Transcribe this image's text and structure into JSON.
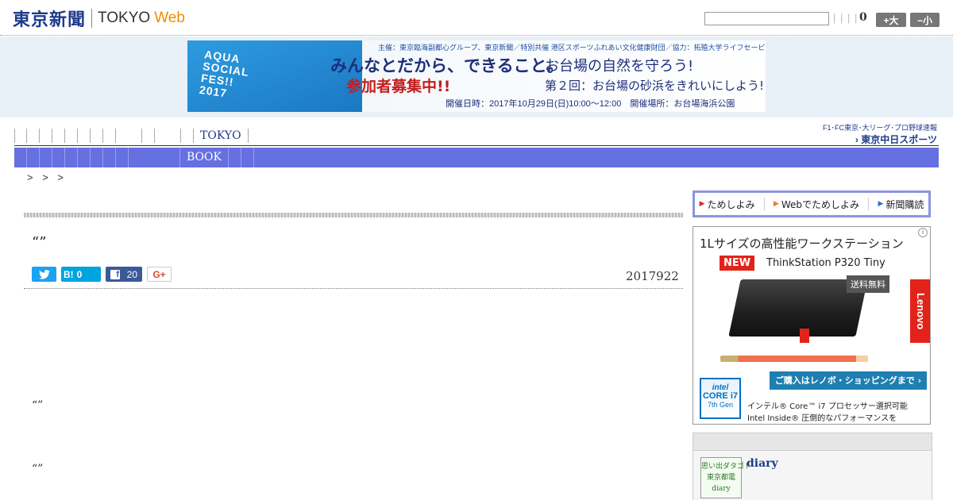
{
  "header": {
    "logo_jp": "東京新聞",
    "logo_tokyo": "TOKYO",
    "logo_web": "Web",
    "pipes": "| | | |",
    "count": "0",
    "font_big": "+大",
    "font_small": "−小"
  },
  "banner": {
    "shirt_text": "AQUA\nSOCIAL\nFES!!\n2017",
    "top_line": "主催：東京臨海副都心グループ、東京新聞／特別共催 港区スポーツふれあい文化健康財団／協力：拓殖大学ライフセービング部",
    "main1": "みんなとだから、できること。",
    "main2": "お台場の自然を守ろう!",
    "sub1": "参加者募集中!!",
    "sub2": "第２回：お台場の砂浜をきれいにしよう!",
    "bottom_line": "開催日時：2017年10月29日(日)10:00〜12:00　開催場所：お台場海浜公園"
  },
  "gnav": {
    "label": "TOKYO"
  },
  "chunichi": {
    "line1": "F1･FC東京･大リーグ･プロ野球速報",
    "line2": "› 東京中日スポーツ"
  },
  "subnav": {
    "label": "BOOK"
  },
  "breadcrumb": ">   > >",
  "article": {
    "title": "“”",
    "date": "2017922",
    "quote1": "“”",
    "quote2": "“”"
  },
  "share": {
    "twitter_icon": "twitter-icon",
    "hatena_label": "B!",
    "hatena_count": "0",
    "fb_label": "f",
    "fb_count": "20",
    "gplus_label": "G+"
  },
  "sidebar": {
    "tame_items": [
      "ためしよみ",
      "Webでためしよみ",
      "新聞購読"
    ],
    "ad": {
      "title": "1Lサイズの高性能ワークステーション",
      "new": "NEW",
      "model": "ThinkStation P320 Tiny",
      "free": "送料無料",
      "lenovo": "Lenovo",
      "cta": "ご購入はレノボ・ショッピングまで ›",
      "intel_brand": "intel",
      "intel_core": "CORE i7",
      "intel_gen": "7th Gen",
      "line1": "インテル® Core™ i7 プロセッサー選択可能",
      "line2": "Intel Inside® 圧倒的なパフォーマンスを"
    },
    "diary": {
      "thumb_text": "思い出ダタゴト\n東京都電\ndiary",
      "title": "diary"
    }
  }
}
